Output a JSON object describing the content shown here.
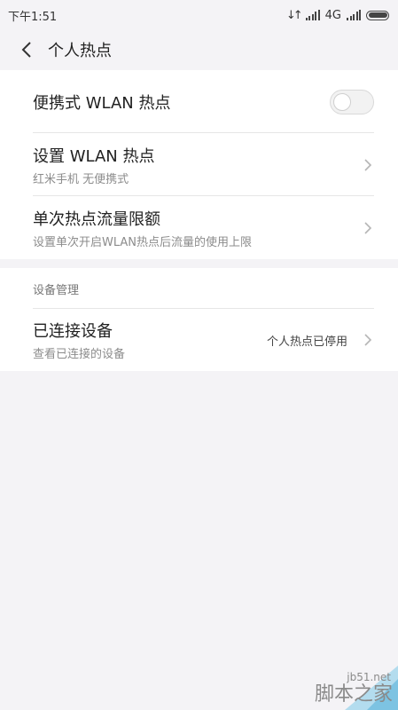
{
  "status": {
    "time": "下午1:51",
    "network": "4G"
  },
  "header": {
    "title": "个人热点",
    "back_icon": "chevron-left-icon"
  },
  "hotspot": {
    "portable_label": "便携式 WLAN 热点",
    "portable_enabled": false,
    "setup_label": "设置 WLAN 热点",
    "setup_sub": "红米手机 无便携式",
    "limit_label": "单次热点流量限额",
    "limit_sub": "设置单次开启WLAN热点后流量的使用上限"
  },
  "devices": {
    "section_title": "设备管理",
    "connected_label": "已连接设备",
    "connected_sub": "查看已连接的设备",
    "connected_value": "个人热点已停用"
  },
  "watermark": {
    "url": "jb51.net",
    "name": "脚本之家"
  },
  "colors": {
    "background": "#f4f3f6",
    "card": "#ffffff",
    "primary_text": "#222222",
    "secondary_text": "#8c8c8c"
  }
}
